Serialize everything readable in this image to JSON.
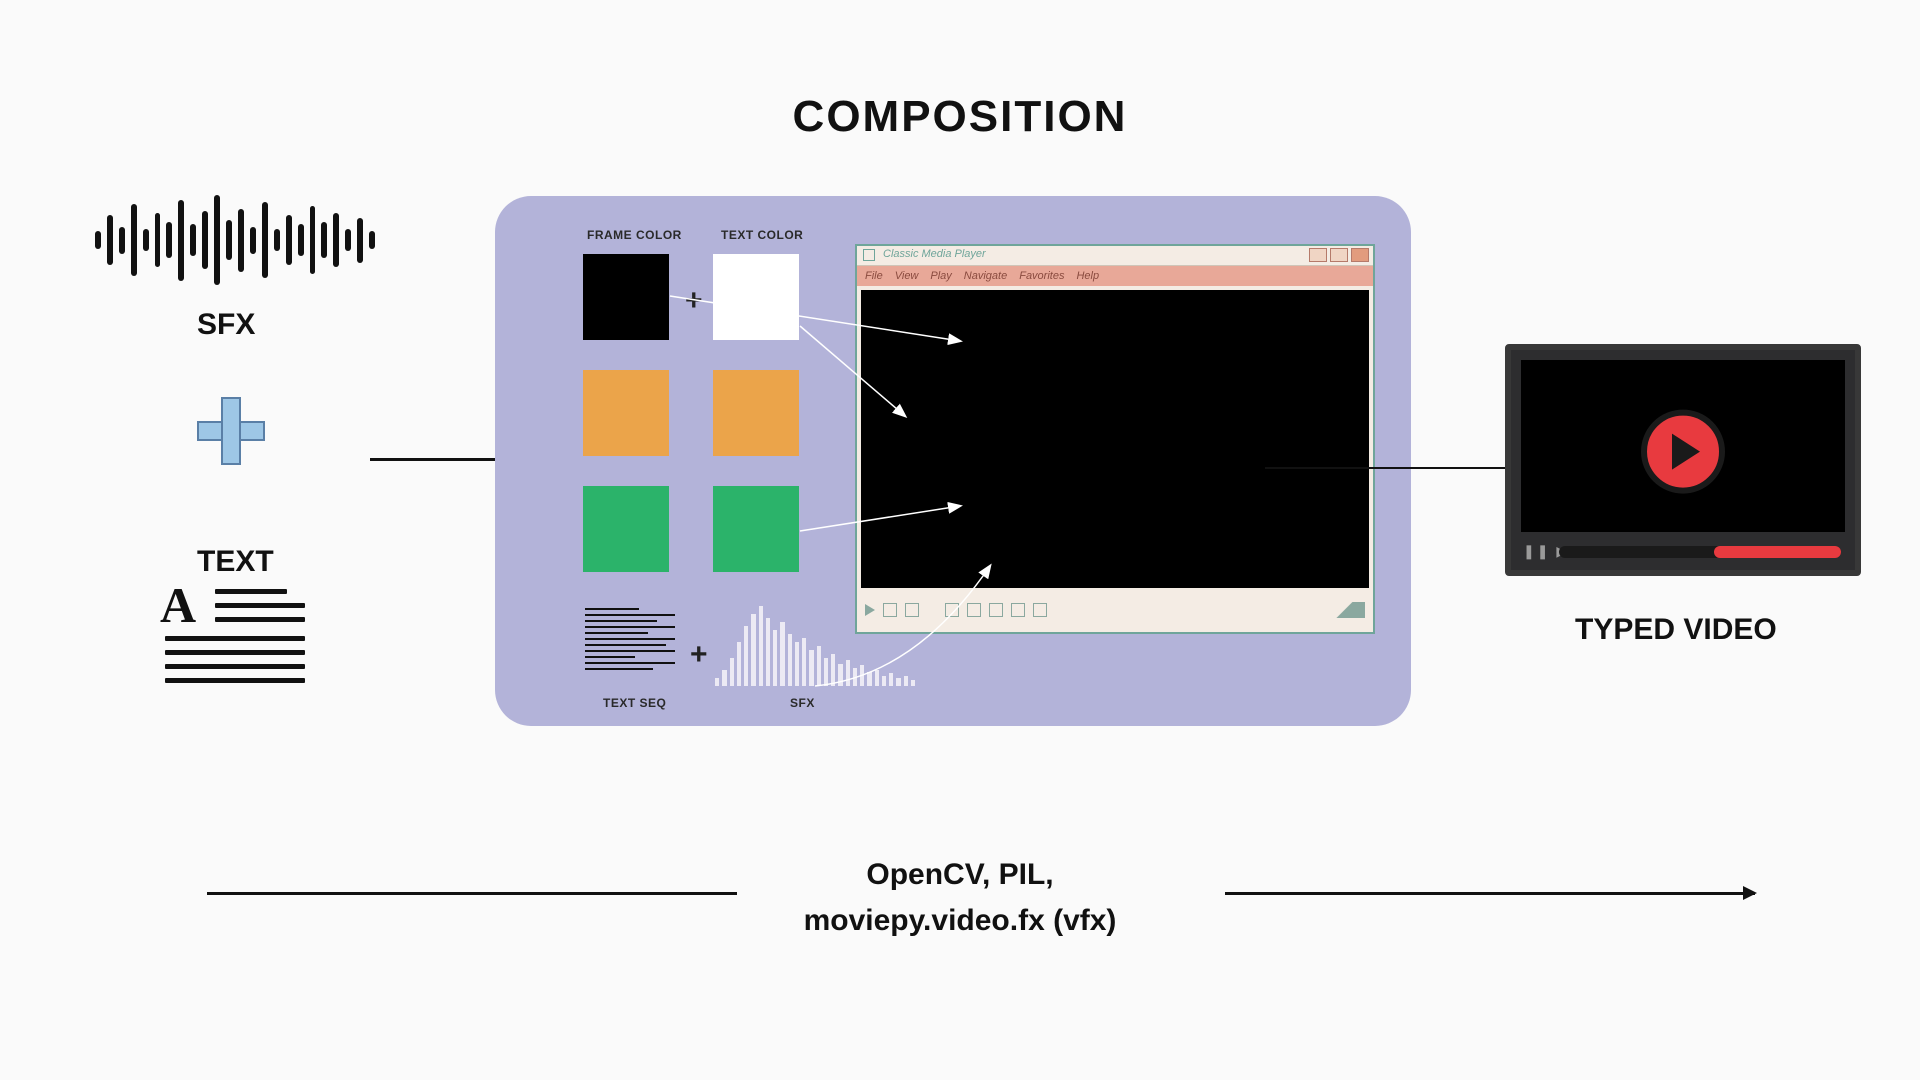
{
  "title": "COMPOSITION",
  "inputs": {
    "sfx_label": "SFX",
    "text_label": "TEXT"
  },
  "panel": {
    "frame_color_label": "FRAME COLOR",
    "text_color_label": "TEXT COLOR",
    "text_seq_label": "TEXT SEQ",
    "sfx_label": "SFX",
    "swatches": {
      "row1": {
        "frame": "#000000",
        "text": "#ffffff"
      },
      "row2": {
        "frame": "#eba44a",
        "text": "#eba44a"
      },
      "row3": {
        "frame": "#2bb36a",
        "text": "#2bb36a"
      }
    },
    "player": {
      "title": "Classic Media Player",
      "menus": [
        "File",
        "View",
        "Play",
        "Navigate",
        "Favorites",
        "Help"
      ]
    }
  },
  "output": {
    "label": "TYPED VIDEO"
  },
  "footer": {
    "line1": "OpenCV, PIL,",
    "line2": "moviepy.video.fx (vfx)"
  }
}
